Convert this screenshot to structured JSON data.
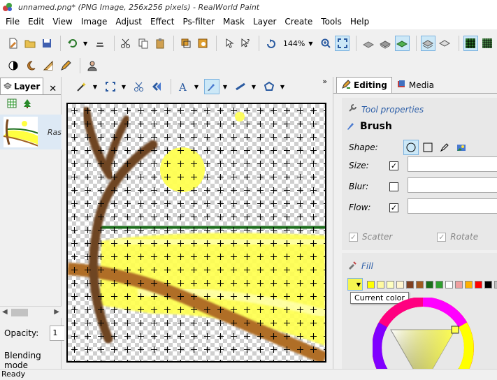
{
  "window": {
    "title": "unnamed.png* (PNG Image, 256x256 pixels) - RealWorld Paint"
  },
  "menu": [
    "File",
    "Edit",
    "View",
    "Image",
    "Adjust",
    "Effect",
    "Ps-filter",
    "Mask",
    "Layer",
    "Create",
    "Tools",
    "Help"
  ],
  "toolbar": {
    "zoom": "144%",
    "overflow": "»"
  },
  "layers_panel": {
    "tab_label": "Layer",
    "close": "✕",
    "layer_name": "Ras",
    "opacity_label": "Opacity:",
    "opacity_value": "1",
    "blending_label": "Blending mode"
  },
  "right_panel": {
    "tabs": [
      {
        "label": "Editing",
        "active": true
      },
      {
        "label": "Media",
        "active": false
      }
    ],
    "tool_properties_title": "Tool properties",
    "tool_name": "Brush",
    "props": {
      "shape_label": "Shape:",
      "size_label": "Size:",
      "blur_label": "Blur:",
      "flow_label": "Flow:",
      "size_checked": true,
      "blur_checked": false,
      "flow_checked": true,
      "scatter_label": "Scatter",
      "rotate_label": "Rotate"
    },
    "fill_title": "Fill",
    "current_color": "#f5f550",
    "tooltip": "Current color",
    "swatches": [
      "#ffff00",
      "#fffaa0",
      "#ffffc0",
      "#fff5d0",
      "#804020",
      "#a05a20",
      "#1a6e1a",
      "#30a030",
      "#ffffff",
      "#f0a0a0",
      "#ffb000",
      "#ff0000",
      "#000000",
      "#c0c0c0"
    ]
  },
  "status": {
    "text": "Ready"
  }
}
